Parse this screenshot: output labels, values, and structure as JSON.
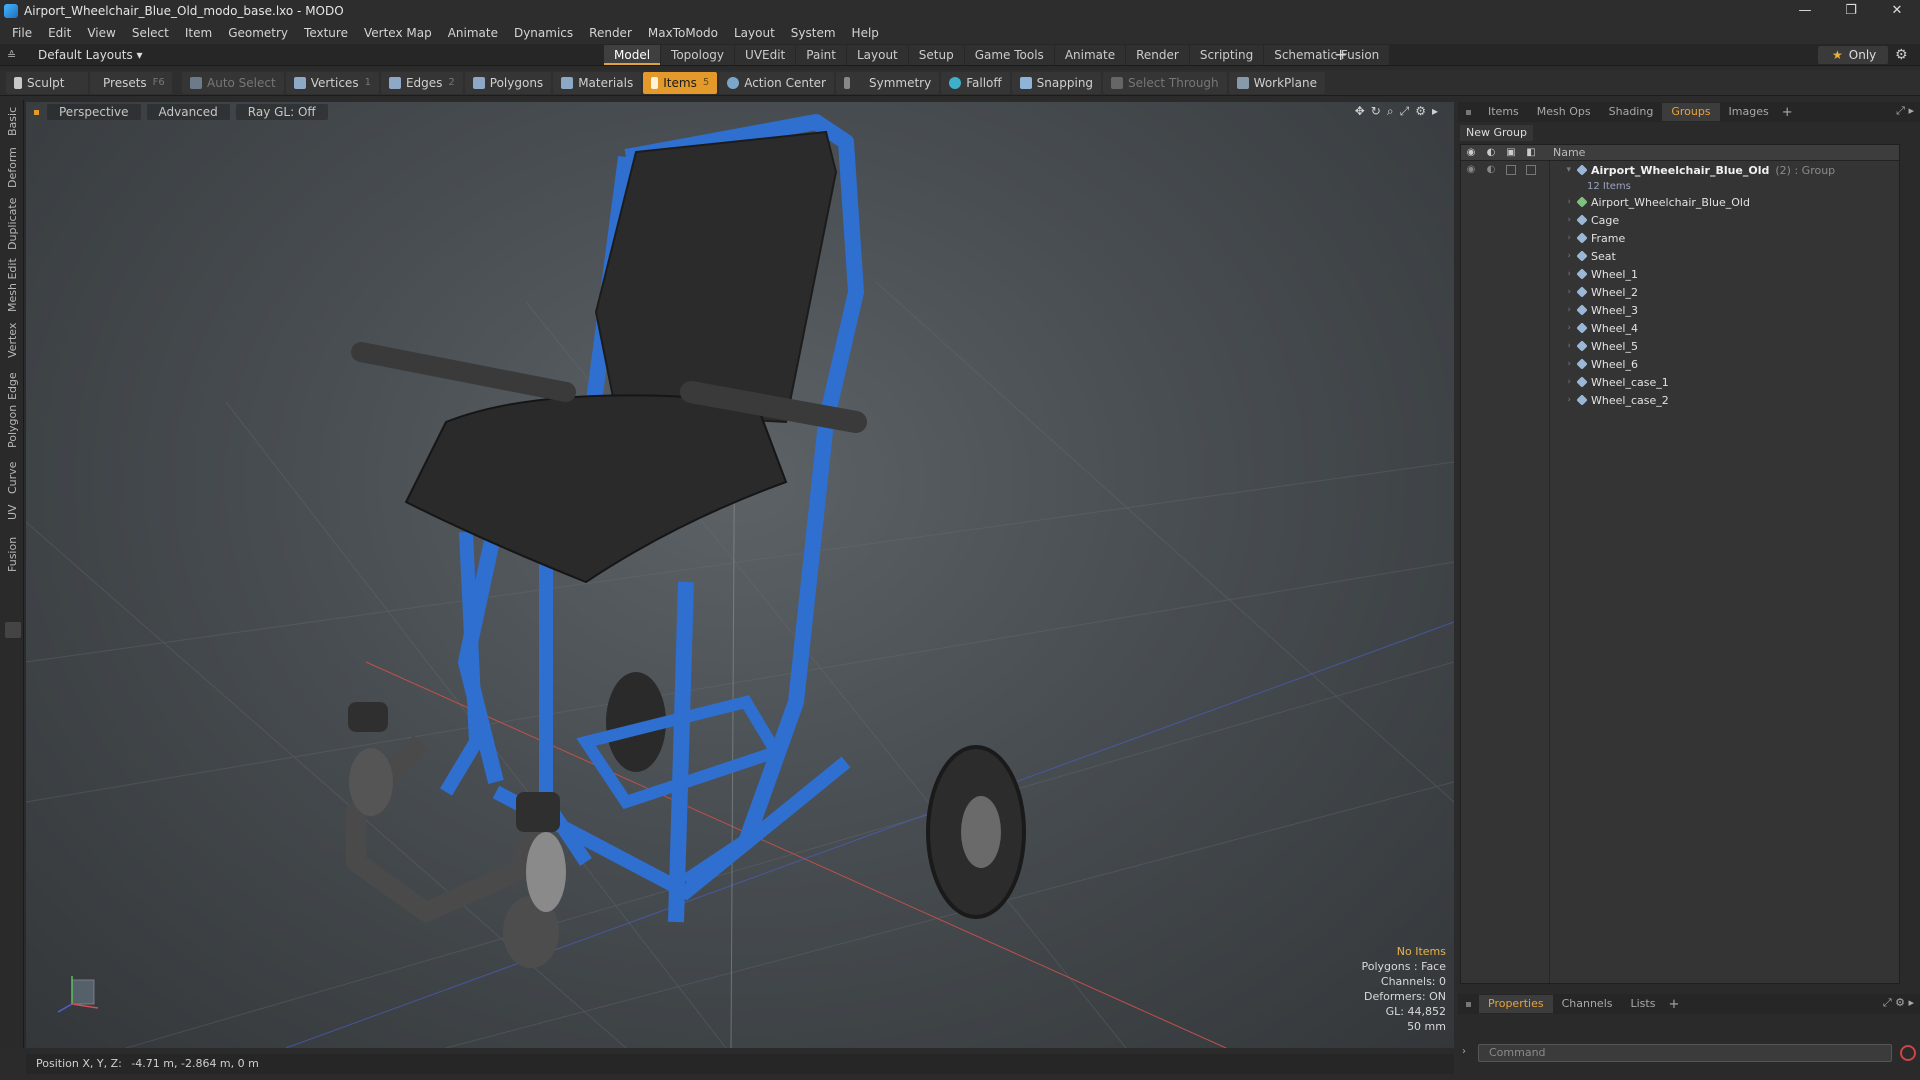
{
  "window": {
    "title": "Airport_Wheelchair_Blue_Old_modo_base.lxo - MODO",
    "controls": [
      "—",
      "❐",
      "✕"
    ]
  },
  "menu": [
    "File",
    "Edit",
    "View",
    "Select",
    "Item",
    "Geometry",
    "Texture",
    "Vertex Map",
    "Animate",
    "Dynamics",
    "Render",
    "MaxToModo",
    "Layout",
    "System",
    "Help"
  ],
  "layout": {
    "selector": "Default Layouts ▾",
    "tabs": [
      "Model",
      "Topology",
      "UVEdit",
      "Paint",
      "Layout",
      "Setup",
      "Game Tools",
      "Animate",
      "Render",
      "Scripting",
      "Schematic Fusion"
    ],
    "active_tab": "Model",
    "only_label": "Only"
  },
  "toolbar": {
    "sculpt": "Sculpt",
    "presets": "Presets",
    "presets_key": "F6",
    "auto_select": "Auto Select",
    "vertices": "Vertices",
    "vertices_count": "1",
    "edges": "Edges",
    "edges_count": "2",
    "polygons": "Polygons",
    "materials": "Materials",
    "items": "Items",
    "items_count": "5",
    "action_center": "Action Center",
    "symmetry": "Symmetry",
    "falloff": "Falloff",
    "snapping": "Snapping",
    "select_through": "Select Through",
    "workplane": "WorkPlane"
  },
  "left_tabs": [
    "Basic",
    "Deform",
    "Duplicate",
    "Mesh Edit",
    "Vertex",
    "Edge",
    "Polygon",
    "Curve",
    "UV",
    "Fusion"
  ],
  "viewport": {
    "view_mode": "Perspective",
    "advanced": "Advanced",
    "raygl": "Ray GL: Off",
    "info": {
      "no_items": "No Items",
      "polygons": "Polygons : Face",
      "channels": "Channels: 0",
      "deformers": "Deformers: ON",
      "gl": "GL: 44,852",
      "focal": "50 mm"
    }
  },
  "status": {
    "label": "Position X, Y, Z:",
    "value": "-4.71 m, -2.864 m, 0 m"
  },
  "panel": {
    "tabs": [
      "Items",
      "Mesh Ops",
      "Shading",
      "Groups",
      "Images"
    ],
    "active_tab": "Groups",
    "new_group": "New Group",
    "name_header": "Name",
    "group": {
      "name": "Airport_Wheelchair_Blue_Old",
      "type": "(2) : Group",
      "count": "12 Items"
    },
    "items": [
      "Airport_Wheelchair_Blue_Old",
      "Cage",
      "Frame",
      "Seat",
      "Wheel_1",
      "Wheel_2",
      "Wheel_3",
      "Wheel_4",
      "Wheel_5",
      "Wheel_6",
      "Wheel_case_1",
      "Wheel_case_2"
    ]
  },
  "bottom_panel": {
    "tabs": [
      "Properties",
      "Channels",
      "Lists"
    ],
    "active_tab": "Properties",
    "command_placeholder": "Command"
  },
  "colors": {
    "accent": "#e39a2b",
    "wheelchair_frame": "#2f6fd0",
    "seat": "#2a2a2a"
  }
}
